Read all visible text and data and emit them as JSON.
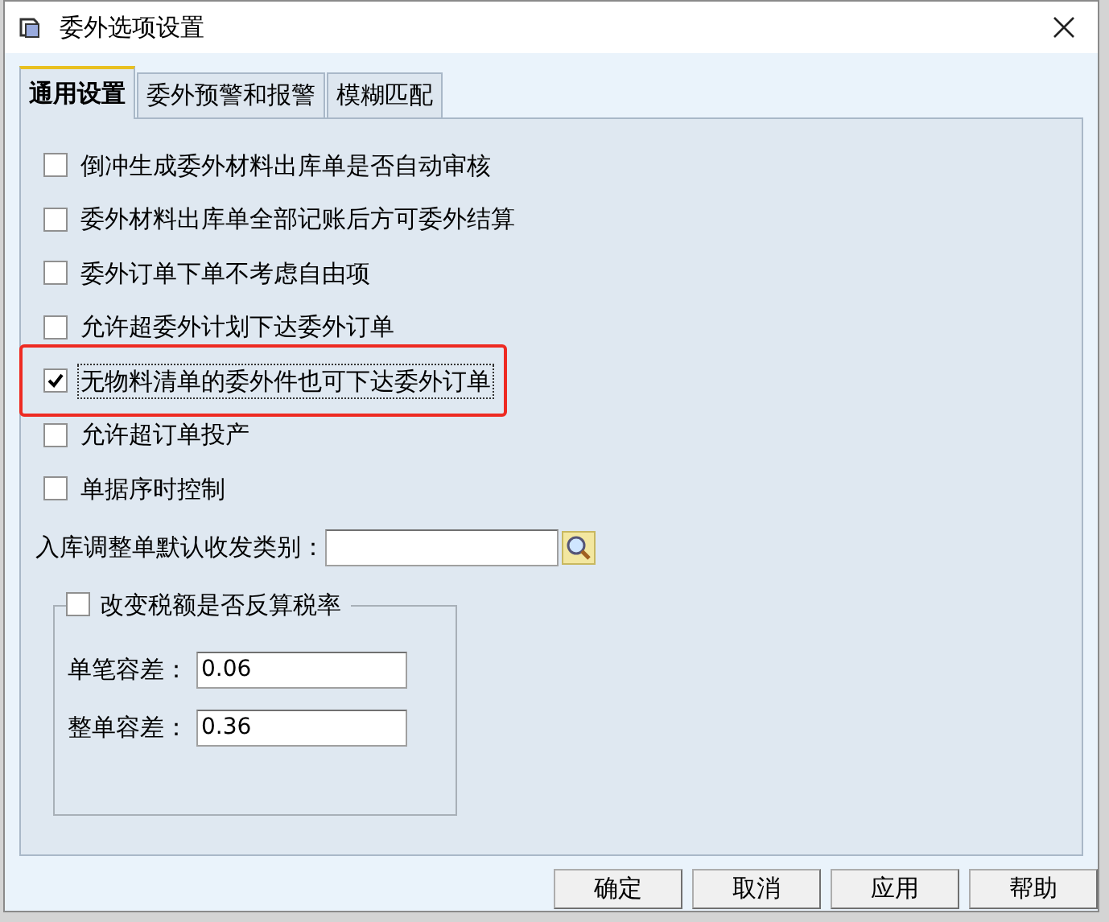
{
  "window": {
    "title": "委外选项设置"
  },
  "tabs": [
    {
      "label": "通用设置",
      "selected": true
    },
    {
      "label": "委外预警和报警",
      "selected": false
    },
    {
      "label": "模糊匹配",
      "selected": false
    }
  ],
  "options": [
    {
      "label": "倒冲生成委外材料出库单是否自动审核",
      "checked": false,
      "focused": false,
      "highlighted": false
    },
    {
      "label": "委外材料出库单全部记账后方可委外结算",
      "checked": false,
      "focused": false,
      "highlighted": false
    },
    {
      "label": "委外订单下单不考虑自由项",
      "checked": false,
      "focused": false,
      "highlighted": false
    },
    {
      "label": "允许超委外计划下达委外订单",
      "checked": false,
      "focused": false,
      "highlighted": false
    },
    {
      "label": "无物料清单的委外件也可下达委外订单",
      "checked": true,
      "focused": true,
      "highlighted": true
    },
    {
      "label": "允许超订单投产",
      "checked": false,
      "focused": false,
      "highlighted": false
    },
    {
      "label": "单据序时控制",
      "checked": false,
      "focused": false,
      "highlighted": false
    }
  ],
  "category_field": {
    "label": "入库调整单默认收发类别："
  },
  "tax_group": {
    "label": "改变税额是否反算税率",
    "checked": false,
    "fields": [
      {
        "label": "单笔容差：",
        "value": "0.06"
      },
      {
        "label": "整单容差：",
        "value": "0.36"
      }
    ]
  },
  "buttons": [
    "确定",
    "取消",
    "应用",
    "帮助"
  ]
}
